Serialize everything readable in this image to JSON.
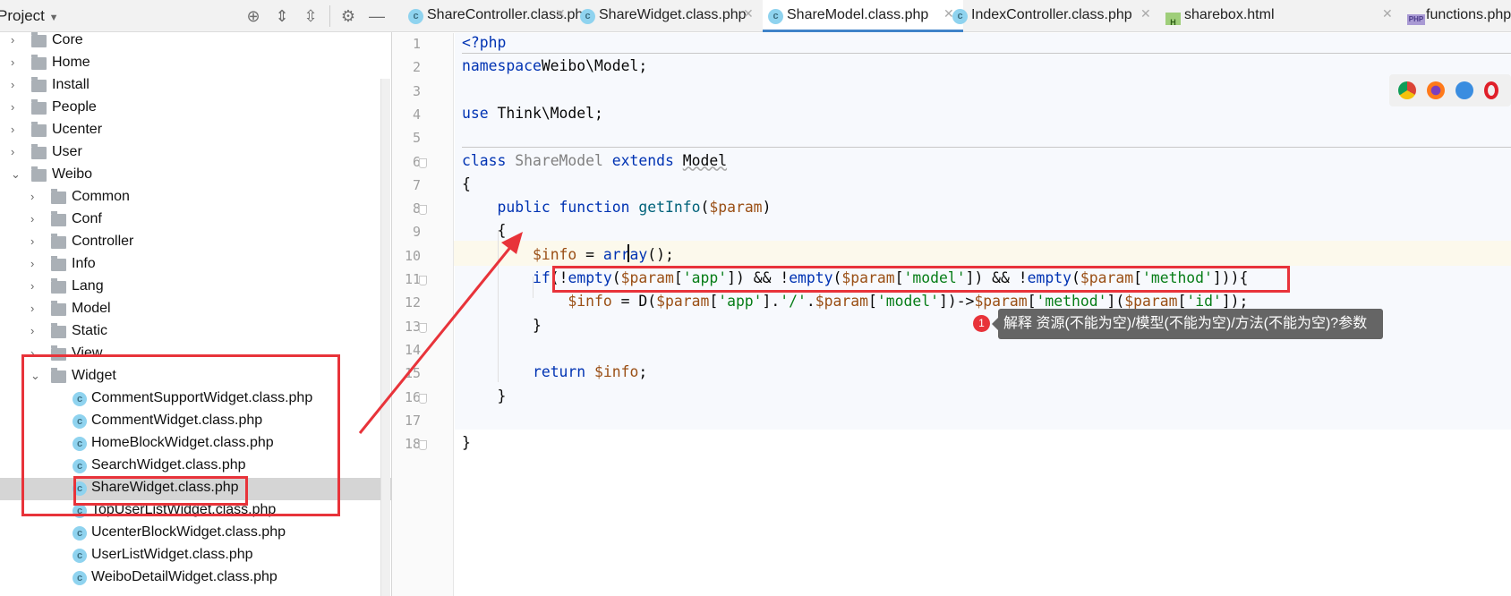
{
  "sidebar": {
    "title": "Project",
    "header_icons": [
      "locate-icon",
      "expand-all-icon",
      "collapse-all-icon",
      "gear-icon",
      "minimize-icon"
    ],
    "items": [
      {
        "label": "Core",
        "type": "folder",
        "level": 1,
        "expanded": false
      },
      {
        "label": "Home",
        "type": "folder",
        "level": 1,
        "expanded": false
      },
      {
        "label": "Install",
        "type": "folder",
        "level": 1,
        "expanded": false
      },
      {
        "label": "People",
        "type": "folder",
        "level": 1,
        "expanded": false
      },
      {
        "label": "Ucenter",
        "type": "folder",
        "level": 1,
        "expanded": false
      },
      {
        "label": "User",
        "type": "folder",
        "level": 1,
        "expanded": false
      },
      {
        "label": "Weibo",
        "type": "folder",
        "level": 1,
        "expanded": true
      },
      {
        "label": "Common",
        "type": "folder",
        "level": 2,
        "expanded": false
      },
      {
        "label": "Conf",
        "type": "folder",
        "level": 2,
        "expanded": false
      },
      {
        "label": "Controller",
        "type": "folder",
        "level": 2,
        "expanded": false
      },
      {
        "label": "Info",
        "type": "folder",
        "level": 2,
        "expanded": false
      },
      {
        "label": "Lang",
        "type": "folder",
        "level": 2,
        "expanded": false
      },
      {
        "label": "Model",
        "type": "folder",
        "level": 2,
        "expanded": false
      },
      {
        "label": "Static",
        "type": "folder",
        "level": 2,
        "expanded": false
      },
      {
        "label": "View",
        "type": "folder",
        "level": 2,
        "expanded": false
      },
      {
        "label": "Widget",
        "type": "folder",
        "level": 2,
        "expanded": true
      },
      {
        "label": "CommentSupportWidget.class.php",
        "type": "file",
        "level": 3
      },
      {
        "label": "CommentWidget.class.php",
        "type": "file",
        "level": 3
      },
      {
        "label": "HomeBlockWidget.class.php",
        "type": "file",
        "level": 3
      },
      {
        "label": "SearchWidget.class.php",
        "type": "file",
        "level": 3
      },
      {
        "label": "ShareWidget.class.php",
        "type": "file",
        "level": 3,
        "selected": true
      },
      {
        "label": "TopUserListWidget.class.php",
        "type": "file",
        "level": 3
      },
      {
        "label": "UcenterBlockWidget.class.php",
        "type": "file",
        "level": 3
      },
      {
        "label": "UserListWidget.class.php",
        "type": "file",
        "level": 3
      },
      {
        "label": "WeiboDetailWidget.class.php",
        "type": "file",
        "level": 3
      }
    ]
  },
  "tabs": [
    {
      "label": "ShareController.class.php",
      "icon": "c"
    },
    {
      "label": "ShareWidget.class.php",
      "icon": "c"
    },
    {
      "label": "ShareModel.class.php",
      "icon": "c",
      "active": true
    },
    {
      "label": "IndexController.class.php",
      "icon": "c"
    },
    {
      "label": "sharebox.html",
      "icon": "html"
    },
    {
      "label": "functions.php",
      "icon": "php"
    }
  ],
  "editor": {
    "current_line": 10,
    "lines": [
      [
        [
          "k",
          "<?php"
        ]
      ],
      [
        [
          "k",
          "namespace"
        ],
        [
          "",
          "Weibo\\Model;"
        ]
      ],
      [],
      [
        [
          "k",
          "use"
        ],
        [
          "",
          " Think\\Model;"
        ]
      ],
      [],
      [
        [
          "k",
          "class"
        ],
        [
          "",
          " "
        ],
        [
          "g",
          "ShareModel"
        ],
        [
          "",
          " "
        ],
        [
          "k",
          "extends"
        ],
        [
          "",
          " "
        ],
        [
          "u",
          "Model"
        ]
      ],
      [
        [
          "",
          "{"
        ]
      ],
      [
        [
          "",
          "    "
        ],
        [
          "k",
          "public function"
        ],
        [
          "",
          " "
        ],
        [
          "f",
          "getInfo"
        ],
        [
          "",
          "("
        ],
        [
          "v",
          "$param"
        ],
        [
          "",
          ")"
        ]
      ],
      [
        [
          "",
          "    {"
        ]
      ],
      [
        [
          "",
          "        "
        ],
        [
          "v",
          "$info"
        ],
        [
          "",
          " = "
        ],
        [
          "k",
          "array"
        ],
        [
          "",
          "();"
        ]
      ],
      [
        [
          "",
          "        "
        ],
        [
          "k",
          "if"
        ],
        [
          "",
          "(!"
        ],
        [
          "k",
          "empty"
        ],
        [
          "",
          "("
        ],
        [
          "v",
          "$param"
        ],
        [
          "",
          "["
        ],
        [
          "s",
          "'app'"
        ],
        [
          "",
          "]) && !"
        ],
        [
          "k",
          "empty"
        ],
        [
          "",
          "("
        ],
        [
          "v",
          "$param"
        ],
        [
          "",
          "["
        ],
        [
          "s",
          "'model'"
        ],
        [
          "",
          "]) && !"
        ],
        [
          "k",
          "empty"
        ],
        [
          "",
          "("
        ],
        [
          "v",
          "$param"
        ],
        [
          "",
          "["
        ],
        [
          "s",
          "'method'"
        ],
        [
          "",
          "])){"
        ]
      ],
      [
        [
          "",
          "            "
        ],
        [
          "v",
          "$info"
        ],
        [
          "",
          " = D("
        ],
        [
          "v",
          "$param"
        ],
        [
          "",
          "["
        ],
        [
          "s",
          "'app'"
        ],
        [
          "",
          "]."
        ],
        [
          "s",
          "'/'"
        ],
        [
          "",
          "."
        ],
        [
          "v",
          "$param"
        ],
        [
          "",
          "["
        ],
        [
          "s",
          "'model'"
        ],
        [
          "",
          "])->"
        ],
        [
          "v",
          "$param"
        ],
        [
          "",
          "["
        ],
        [
          "s",
          "'method'"
        ],
        [
          "",
          "]("
        ],
        [
          "v",
          "$param"
        ],
        [
          "",
          "["
        ],
        [
          "s",
          "'id'"
        ],
        [
          "",
          "]);"
        ]
      ],
      [
        [
          "",
          "        }"
        ]
      ],
      [],
      [
        [
          "",
          "        "
        ],
        [
          "k",
          "return"
        ],
        [
          "",
          " "
        ],
        [
          "v",
          "$info"
        ],
        [
          "",
          ";"
        ]
      ],
      [
        [
          "",
          "    }"
        ]
      ],
      [],
      [
        [
          "",
          "}"
        ]
      ]
    ]
  },
  "browser_icons": [
    "chrome-icon",
    "firefox-icon",
    "safari-icon",
    "opera-icon"
  ],
  "annotation": {
    "badge": "1",
    "tooltip": "解释 资源(不能为空)/模型(不能为空)/方法(不能为空)?参数"
  },
  "colors": {
    "highlight_box": "#e8333a",
    "active_tab": "#4083c9"
  }
}
